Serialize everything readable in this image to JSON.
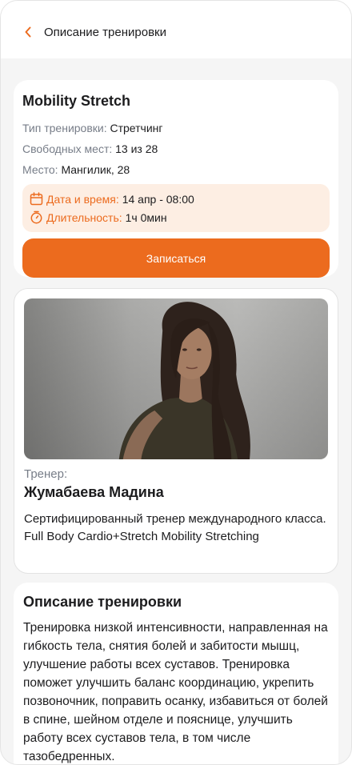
{
  "header": {
    "back_icon": "chevron-left-icon",
    "title": "Описание тренировки"
  },
  "workout": {
    "title": "Mobility Stretch",
    "type_label": "Тип тренировки:",
    "type_value": "Стретчинг",
    "spots_label": "Свободных мест:",
    "spots_value": "13 из 28",
    "place_label": "Место:",
    "place_value": "Мангилик, 28",
    "datetime_label": "Дата и время:",
    "datetime_value": "14 апр - 08:00",
    "duration_label": "Длительность:",
    "duration_value": "1ч 0мин",
    "signup_label": "Записаться"
  },
  "trainer": {
    "label": "Тренер:",
    "name": "Жумабаева Мадина",
    "description": "Сертифицированный тренер международного класса. Full Body Cardio+Stretch Mobility Stretching"
  },
  "description": {
    "title": "Описание тренировки",
    "text": "Тренировка низкой интенсивности, направленная на гибкость тела, снятия болей и забитости мышц, улучшение работы всех суставов. Тренировка поможет улучшить баланс координацию, укрепить позвоночник, поправить осанку, избавиться от болей в спине, шейном отделе и пояснице, улучшить работу всех суставов тела, в том числе тазобедренных."
  },
  "colors": {
    "accent": "#EC6B1E",
    "highlight_bg": "#FDEEE3",
    "label_gray": "#777D88"
  }
}
